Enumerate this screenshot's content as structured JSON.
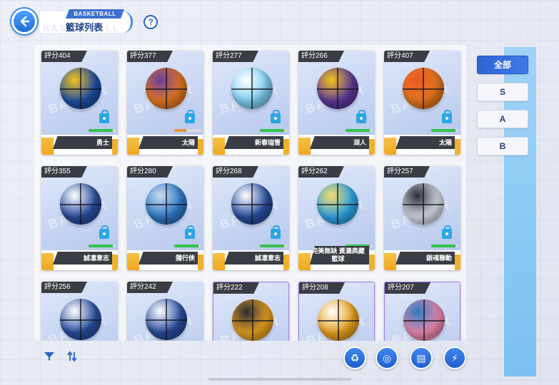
{
  "header": {
    "section_tag": "BASKETBALL",
    "title": "籃球列表",
    "ghost_text": "BASKETBALL",
    "help": "?"
  },
  "filters": [
    {
      "label": "全部",
      "active": true
    },
    {
      "label": "S",
      "active": false
    },
    {
      "label": "A",
      "active": false
    },
    {
      "label": "B",
      "active": false
    }
  ],
  "cards": [
    {
      "score": "評分404",
      "name": "勇士",
      "locked": true,
      "bar": 0.9,
      "bar_color": "green",
      "ball_colors": [
        "#1f4fa8",
        "#f2c21b"
      ],
      "rarity": "gold"
    },
    {
      "score": "評分377",
      "name": "太陽",
      "locked": true,
      "bar": 0.45,
      "bar_color": "orange",
      "ball_colors": [
        "#e6781f",
        "#6a3fa0"
      ],
      "rarity": "gold"
    },
    {
      "score": "評分277",
      "name": "新春瑞雪",
      "locked": true,
      "bar": 0.9,
      "bar_color": "green",
      "ball_colors": [
        "#7fd0f3",
        "#ffffff"
      ],
      "rarity": "gold"
    },
    {
      "score": "評分266",
      "name": "湖人",
      "locked": true,
      "bar": 0.9,
      "bar_color": "green",
      "ball_colors": [
        "#5d3a9e",
        "#f2c21b"
      ],
      "rarity": "gold"
    },
    {
      "score": "評分407",
      "name": "太陽",
      "locked": true,
      "bar": 0.9,
      "bar_color": "green",
      "ball_colors": [
        "#e6781f",
        "#e85a25"
      ],
      "rarity": "gold"
    },
    {
      "score": "評分355",
      "name": "誠凛意志",
      "locked": true,
      "bar": 0.9,
      "bar_color": "green",
      "ball_colors": [
        "#2a4fa0",
        "#ffffff"
      ],
      "rarity": "gold"
    },
    {
      "score": "評分280",
      "name": "獨行俠",
      "locked": true,
      "bar": 0.9,
      "bar_color": "green",
      "ball_colors": [
        "#2f7ac9",
        "#c9dcee"
      ],
      "rarity": "gold"
    },
    {
      "score": "評分268",
      "name": "誠凛意志",
      "locked": true,
      "bar": 0.9,
      "bar_color": "green",
      "ball_colors": [
        "#2a4fa0",
        "#ffffff"
      ],
      "rarity": "gold"
    },
    {
      "score": "評分262",
      "name": "完美無缺 黃瀨典藏籃球",
      "locked": false,
      "bar": 0.9,
      "bar_color": "green",
      "ball_colors": [
        "#2fa6e6",
        "#f3d96a"
      ],
      "rarity": "gold"
    },
    {
      "score": "評分257",
      "name": "銀魂聯動",
      "locked": true,
      "bar": 0.9,
      "bar_color": "green",
      "ball_colors": [
        "#d8dde6",
        "#2a2d35"
      ],
      "rarity": "gold"
    },
    {
      "score": "評分256",
      "name": "",
      "locked": false,
      "bar": 0,
      "bar_color": "green",
      "ball_colors": [
        "#2a4fa0",
        "#ffffff"
      ],
      "rarity": "gold"
    },
    {
      "score": "評分242",
      "name": "",
      "locked": false,
      "bar": 0,
      "bar_color": "green",
      "ball_colors": [
        "#2a4fa0",
        "#ffffff"
      ],
      "rarity": "gold"
    },
    {
      "score": "評分222",
      "name": "",
      "locked": false,
      "bar": 0,
      "bar_color": "green",
      "ball_colors": [
        "#e9a21f",
        "#2a2d35"
      ],
      "rarity": "purple"
    },
    {
      "score": "評分208",
      "name": "",
      "locked": false,
      "bar": 0,
      "bar_color": "green",
      "ball_colors": [
        "#e9a21f",
        "#ffffff"
      ],
      "rarity": "purple"
    },
    {
      "score": "評分207",
      "name": "",
      "locked": false,
      "bar": 0,
      "bar_color": "green",
      "ball_colors": [
        "#ee8ab0",
        "#2a7ac0"
      ],
      "rarity": "purple"
    }
  ],
  "card_watermark": "BAKETR",
  "toolbar": {
    "filter_icon": "filter-icon",
    "sort_icon": "sort-icon",
    "actions": [
      "recycle-icon",
      "basketball-icon",
      "book-icon",
      "shoe-icon"
    ]
  }
}
